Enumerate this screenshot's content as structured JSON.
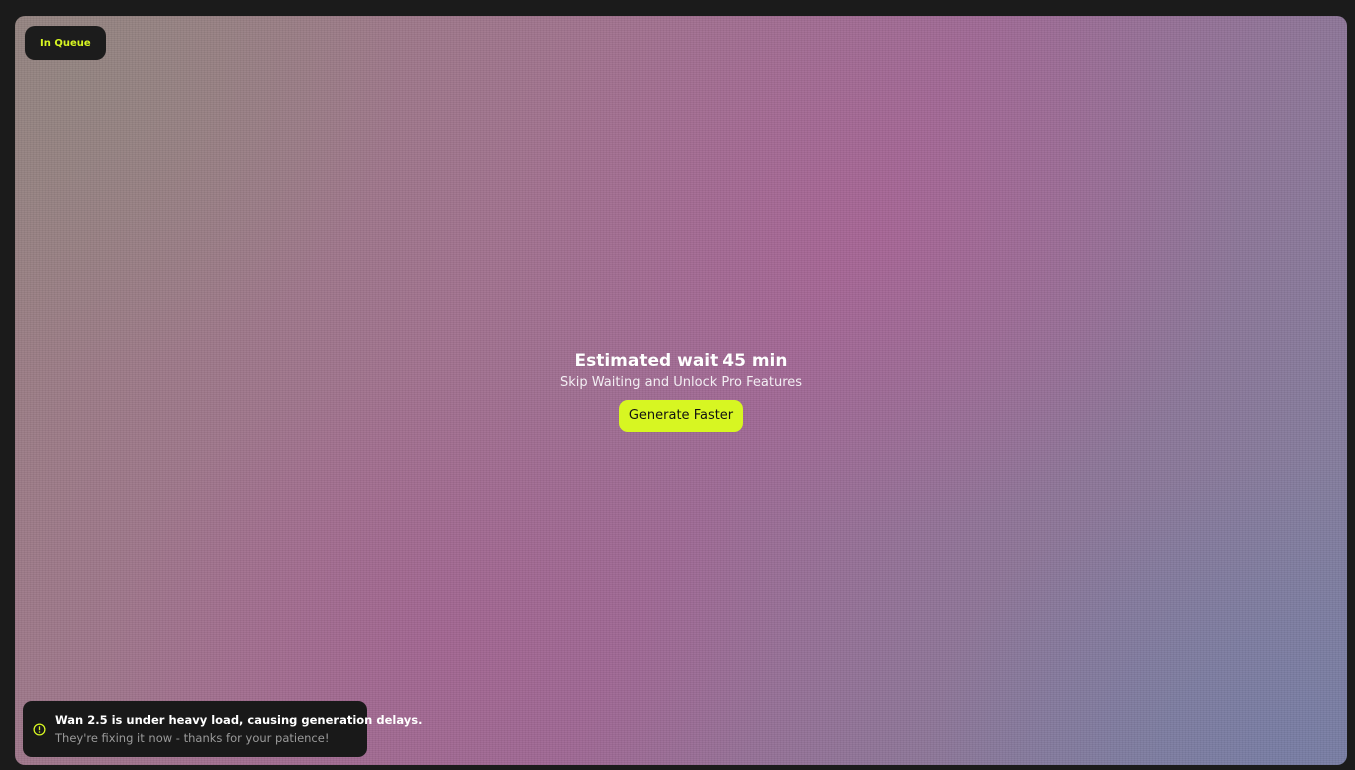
{
  "status_badge": {
    "label": "In Queue"
  },
  "queue": {
    "wait_label": "Estimated wait",
    "wait_value": "45 min",
    "subtitle": "Skip Waiting and Unlock Pro Features",
    "cta_label": "Generate Faster"
  },
  "notice": {
    "icon": "info-icon",
    "title": "Wan 2.5 is under heavy load, causing generation delays.",
    "message": "They're fixing it now - thanks for your patience!"
  },
  "colors": {
    "accent": "#d7f622",
    "badge_bg": "#1c1c1c",
    "toast_bg": "#191919",
    "frame_bg": "#1b1b1b"
  }
}
